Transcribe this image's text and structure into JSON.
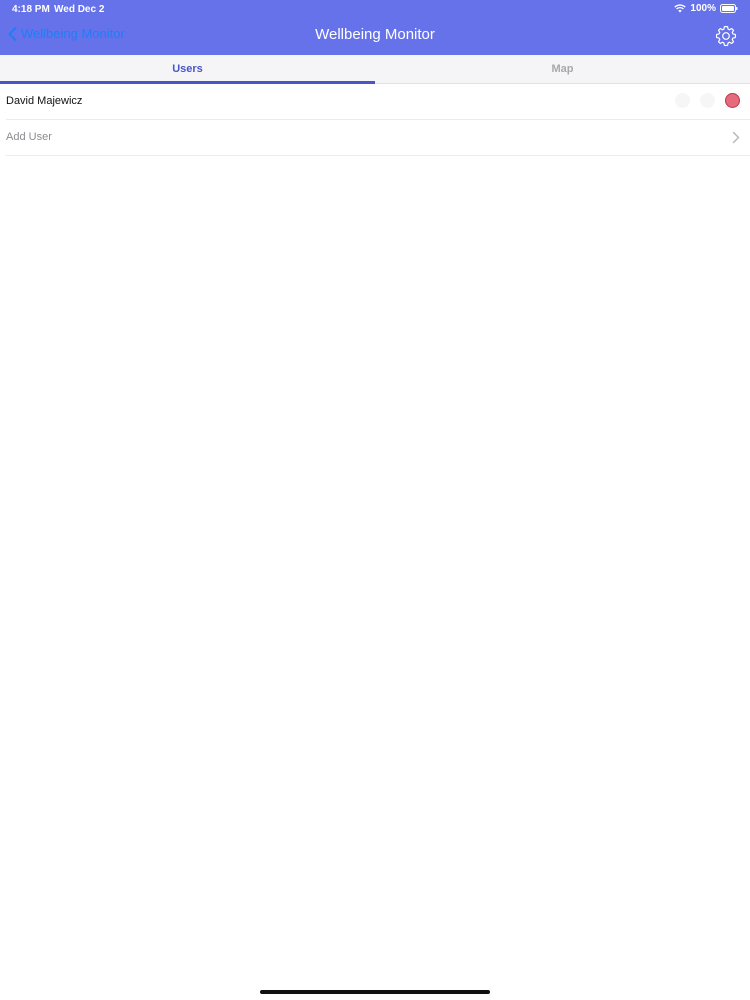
{
  "status_bar": {
    "time": "4:18 PM",
    "date": "Wed Dec 2",
    "battery": "100%",
    "icons": [
      "wifi-icon",
      "battery-icon"
    ]
  },
  "nav": {
    "back_label": "Wellbeing Monitor",
    "title": "Wellbeing Monitor",
    "settings_icon": "gear-icon"
  },
  "tabs": [
    {
      "label": "Users",
      "active": true
    },
    {
      "label": "Map",
      "active": false
    }
  ],
  "users": [
    {
      "name": "David Majewicz",
      "status_color": "#e76a7c"
    }
  ],
  "add_user": {
    "label": "Add User"
  },
  "colors": {
    "header": "#6672ea",
    "accent": "#4a55c9",
    "back_link": "#1f7ef6",
    "status_red": "#e76a7c"
  }
}
